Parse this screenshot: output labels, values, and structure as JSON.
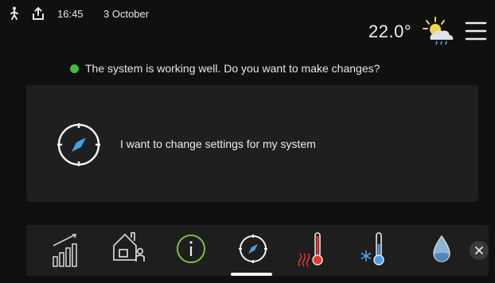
{
  "status_bar": {
    "time": "16:45",
    "date": "3 October",
    "temperature": "22.0°",
    "icons": [
      "person-walking-icon",
      "upload-icon",
      "weather-sun-cloud-icon",
      "menu-icon"
    ]
  },
  "system_status": {
    "indicator_color": "#3fbe3f",
    "message": "The system is working well. Do you want to make changes?"
  },
  "action_card": {
    "icon": "compass-icon",
    "label": "I want to change settings for my system"
  },
  "bottom_nav": {
    "items": [
      {
        "icon": "statistics-bars-icon"
      },
      {
        "icon": "house-user-icon"
      },
      {
        "icon": "info-icon",
        "color": "#7bc142"
      },
      {
        "icon": "compass-icon",
        "active": true
      },
      {
        "icon": "heating-thermometer-icon",
        "color": "#e03a2a"
      },
      {
        "icon": "cooling-thermometer-icon",
        "color": "#4aa0e6"
      },
      {
        "icon": "water-drop-icon",
        "color": "#8ab6d6"
      },
      {
        "icon": "close-icon"
      }
    ]
  },
  "colors": {
    "background": "#101010",
    "panel": "#1f1f1f",
    "text": "#e8e8e8"
  }
}
